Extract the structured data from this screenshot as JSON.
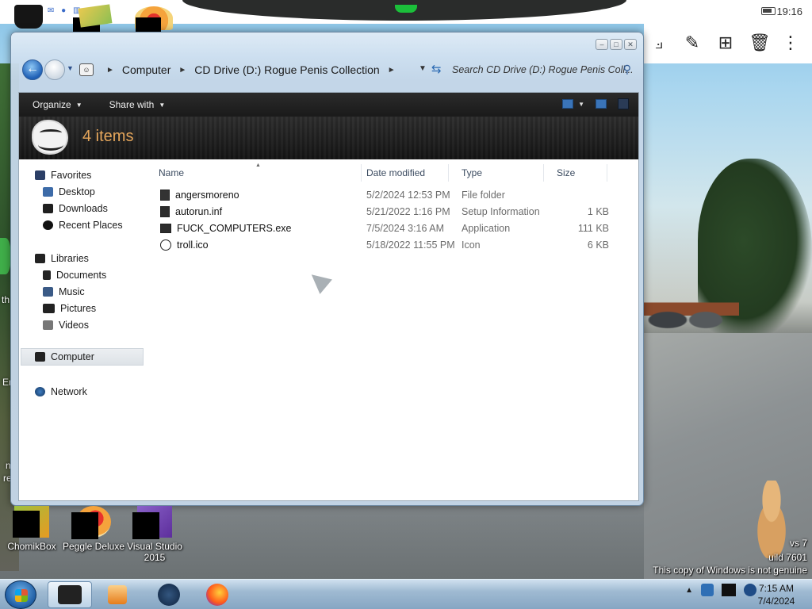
{
  "status_bar": {
    "time": "19:16"
  },
  "window": {
    "address": {
      "segments": [
        "Computer",
        "CD Drive (D:) Rogue Penis Collection"
      ]
    },
    "search_placeholder": "Search CD Drive (D:) Rogue Penis Coll...",
    "command_bar": {
      "organize": "Organize",
      "share_with": "Share with"
    },
    "banner": {
      "items_count": "4 items"
    },
    "nav_pane": {
      "favorites": "Favorites",
      "desktop": "Desktop",
      "downloads": "Downloads",
      "recent_places": "Recent Places",
      "libraries": "Libraries",
      "documents": "Documents",
      "music": "Music",
      "pictures": "Pictures",
      "videos": "Videos",
      "computer": "Computer",
      "network": "Network"
    },
    "columns": {
      "name": "Name",
      "date": "Date modified",
      "type": "Type",
      "size": "Size"
    },
    "files": [
      {
        "name": "angersmoreno",
        "date": "5/2/2024 12:53 PM",
        "type": "File folder",
        "size": ""
      },
      {
        "name": "autorun.inf",
        "date": "5/21/2022 1:16 PM",
        "type": "Setup Information",
        "size": "1 KB"
      },
      {
        "name": "FUCK_COMPUTERS.exe",
        "date": "7/5/2024 3:16 AM",
        "type": "Application",
        "size": "111 KB"
      },
      {
        "name": "troll.ico",
        "date": "5/18/2022 11:55 PM",
        "type": "Icon",
        "size": "6 KB"
      }
    ]
  },
  "desktop": {
    "icons": [
      "ChomikBox",
      "Peggle Deluxe",
      "Visual Studio 2015"
    ],
    "side_fragments": {
      "th": "th",
      "er": "Er",
      "n": "n",
      "re": "re"
    },
    "watermark": {
      "line1": "vs 7",
      "line2": "uild 7601",
      "line3": "This copy of Windows is not genuine"
    }
  },
  "taskbar": {
    "time": "7:15 AM",
    "date": "7/4/2024"
  }
}
